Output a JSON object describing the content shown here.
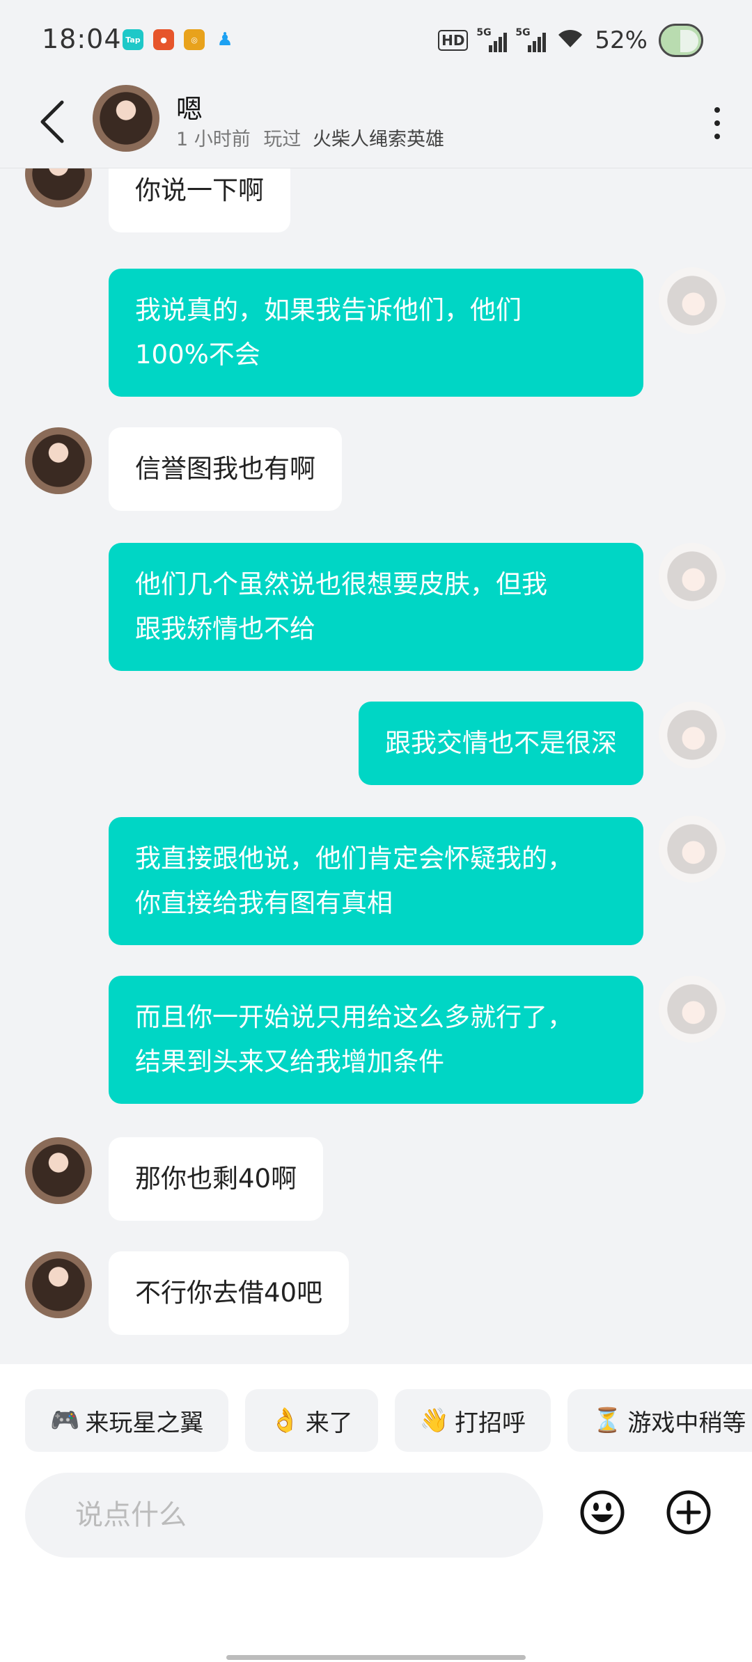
{
  "status_bar": {
    "time": "18:04",
    "apps": [
      {
        "icon": "taptap-icon",
        "label": "Tap",
        "color": "#1ec8c8"
      },
      {
        "icon": "game-app-icon",
        "label": "",
        "color": "#e6552b"
      },
      {
        "icon": "target-app-icon",
        "label": "",
        "color": "#e8a21c"
      },
      {
        "icon": "qq-icon",
        "label": "",
        "color": "#1da1f2"
      }
    ],
    "hd": "HD",
    "net1": "5G",
    "net2": "5G",
    "battery": "52%"
  },
  "header": {
    "name": "嗯",
    "last_active": "1 小时前",
    "played_prefix": "玩过",
    "played_game": "火柴人绳索英雄"
  },
  "messages": [
    {
      "side": "in",
      "lines": [
        "你说一下啊"
      ]
    },
    {
      "side": "out",
      "lines": [
        "我说真的，如果我告诉他们，他们",
        "100%不会"
      ]
    },
    {
      "side": "in",
      "lines": [
        "信誉图我也有啊"
      ]
    },
    {
      "side": "out",
      "lines": [
        "他们几个虽然说也很想要皮肤，但我",
        "跟我矫情也不给"
      ]
    },
    {
      "side": "out",
      "lines": [
        "跟我交情也不是很深"
      ]
    },
    {
      "side": "out",
      "lines": [
        "我直接跟他说，他们肯定会怀疑我的，",
        "你直接给我有图有真相"
      ]
    },
    {
      "side": "out",
      "lines": [
        "而且你一开始说只用给这么多就行了，",
        "结果到头来又给我增加条件"
      ]
    },
    {
      "side": "in",
      "lines": [
        "那你也剩40啊"
      ]
    },
    {
      "side": "in",
      "lines": [
        "不行你去借40吧"
      ]
    }
  ],
  "quick_replies": [
    {
      "emoji": "🎮",
      "label": "来玩星之翼"
    },
    {
      "emoji": "👌",
      "label": "来了"
    },
    {
      "emoji": "👋",
      "label": "打招呼"
    },
    {
      "emoji": "⏳",
      "label": "游戏中稍等"
    }
  ],
  "composer": {
    "placeholder": "说点什么"
  }
}
